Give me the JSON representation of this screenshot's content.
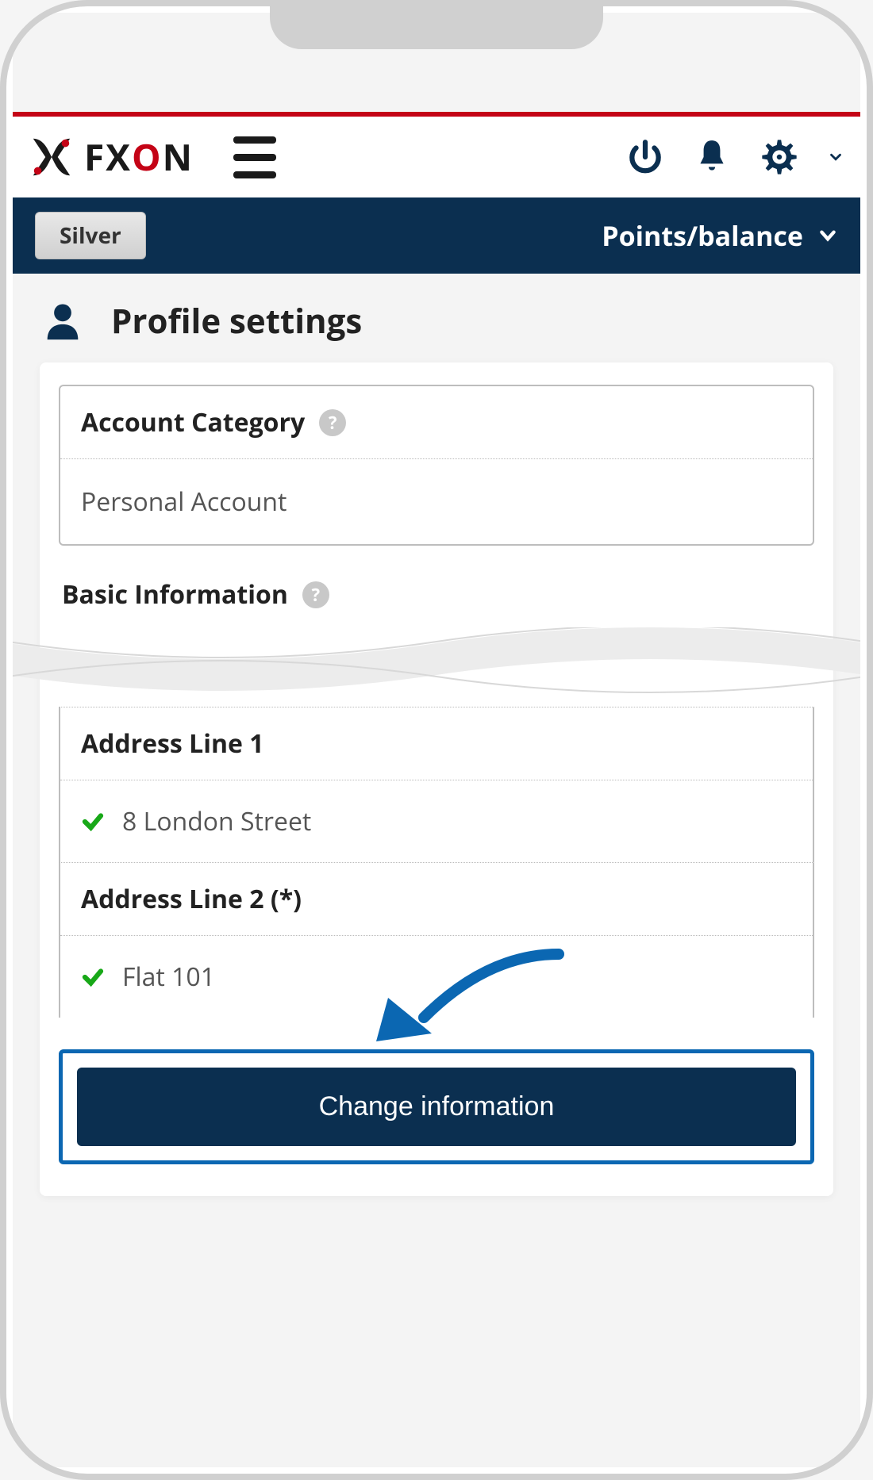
{
  "brand": "FXON",
  "header": {
    "points_label": "Points/balance",
    "tier": "Silver"
  },
  "page": {
    "title": "Profile settings"
  },
  "account_category": {
    "label": "Account Category",
    "value": "Personal Account"
  },
  "basic_info": {
    "label": "Basic Information"
  },
  "fields": {
    "address1": {
      "label": "Address Line 1",
      "value": "8 London Street"
    },
    "address2": {
      "label": "Address Line 2 (*)",
      "value": "Flat 101"
    }
  },
  "cta": {
    "change_info": "Change information"
  }
}
